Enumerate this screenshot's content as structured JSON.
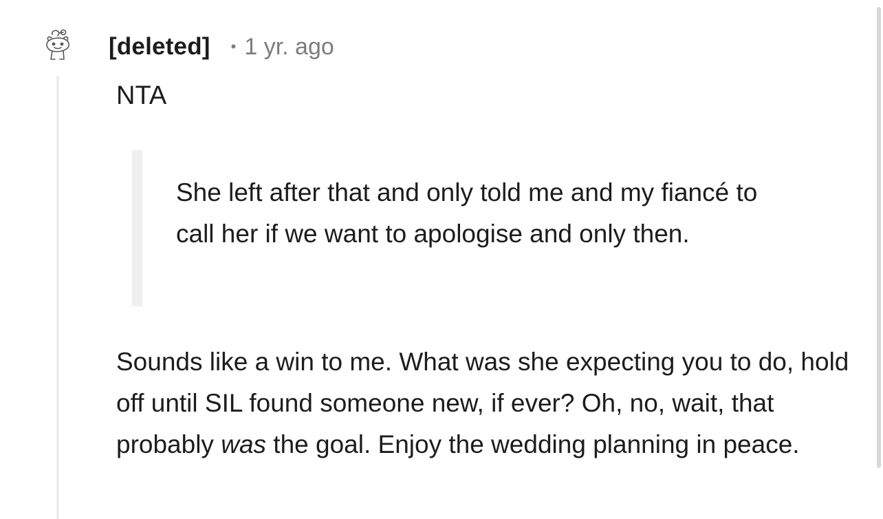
{
  "comment": {
    "author": "[deleted]",
    "separator": "•",
    "timestamp": "1 yr. ago",
    "avatar_icon": "snoo-avatar-icon",
    "verdict": "NTA",
    "quote": "She left after that and only told me and my fiancé to call her if we want to apologise and only then.",
    "body": {
      "part1": "Sounds like a win to me. What was she expecting you to do, hold off until SIL found someone new, if ever? Oh, no, wait, that probably ",
      "emphasis": "was",
      "part2": " the goal. Enjoy the wedding planning in peace."
    }
  },
  "colors": {
    "text": "#1c1c1c",
    "meta": "#7c7c7c",
    "thread_line": "#ededed",
    "quote_bar": "#efefef"
  }
}
